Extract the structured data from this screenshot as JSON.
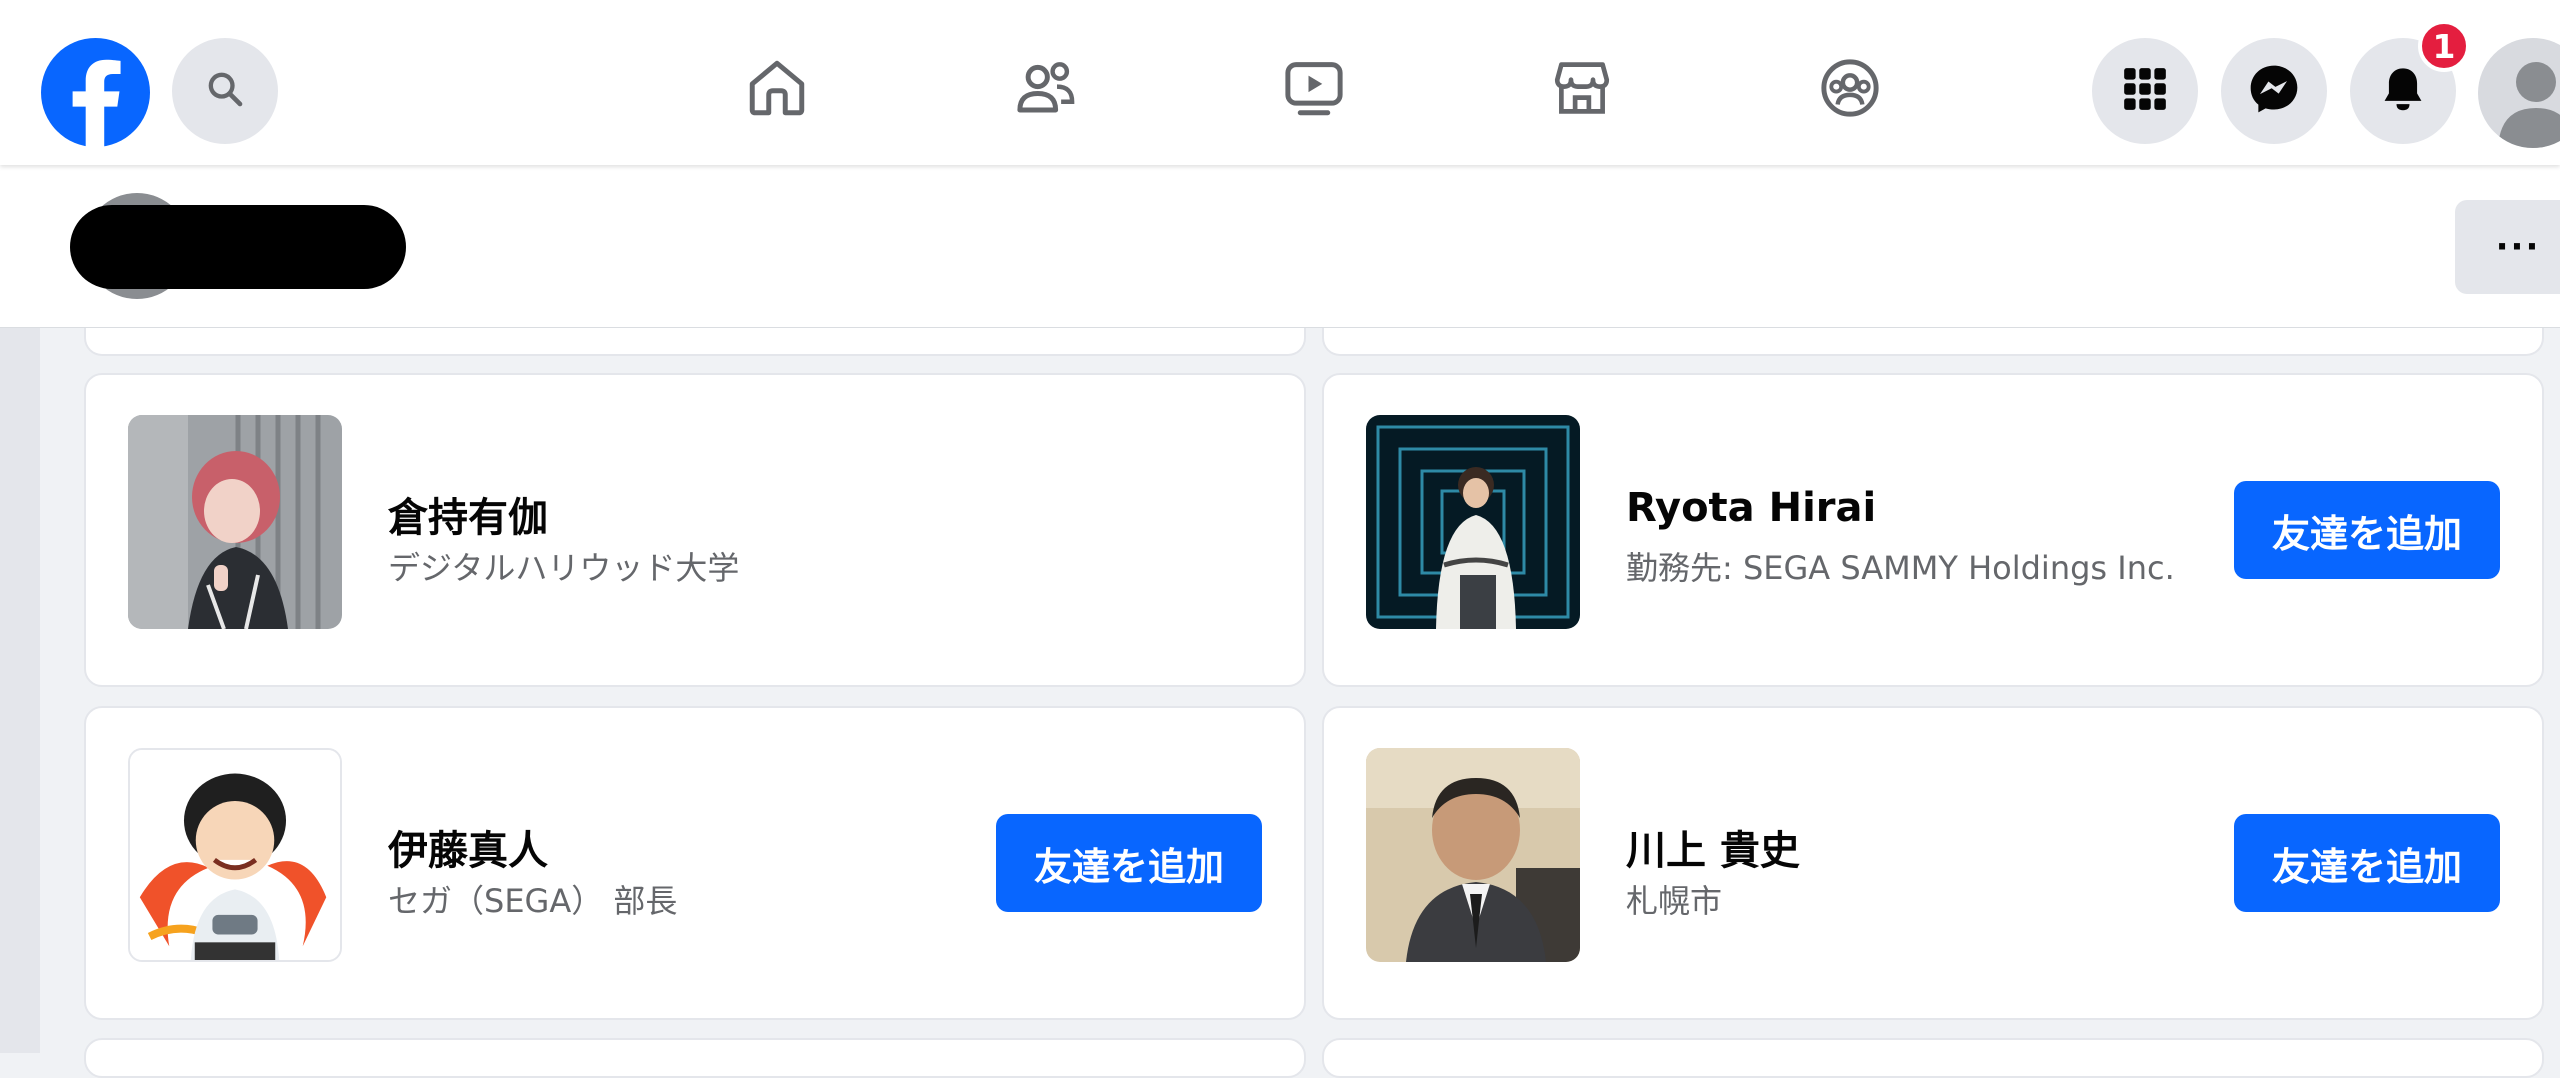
{
  "nav": {
    "brand_color": "#0866ff",
    "notification_count": "1",
    "icons": [
      "search-icon",
      "home-icon",
      "friends-icon",
      "watch-icon",
      "marketplace-icon",
      "groups-icon",
      "menu-grid-icon",
      "messenger-icon",
      "bell-icon",
      "account-avatar"
    ]
  },
  "profile_bar": {
    "more_label": "···"
  },
  "suggestions": [
    {
      "name": "倉持有伽",
      "sub": "デジタルハリウッド大学",
      "button": ""
    },
    {
      "name": "Ryota Hirai",
      "sub": "勤務先: SEGA SAMMY Holdings Inc.",
      "button": "友達を追加"
    },
    {
      "name": "伊藤真人",
      "sub": "セガ（SEGA） 部長",
      "button": "友達を追加"
    },
    {
      "name": "川上 貴史",
      "sub": "札幌市",
      "button": "友達を追加"
    }
  ]
}
